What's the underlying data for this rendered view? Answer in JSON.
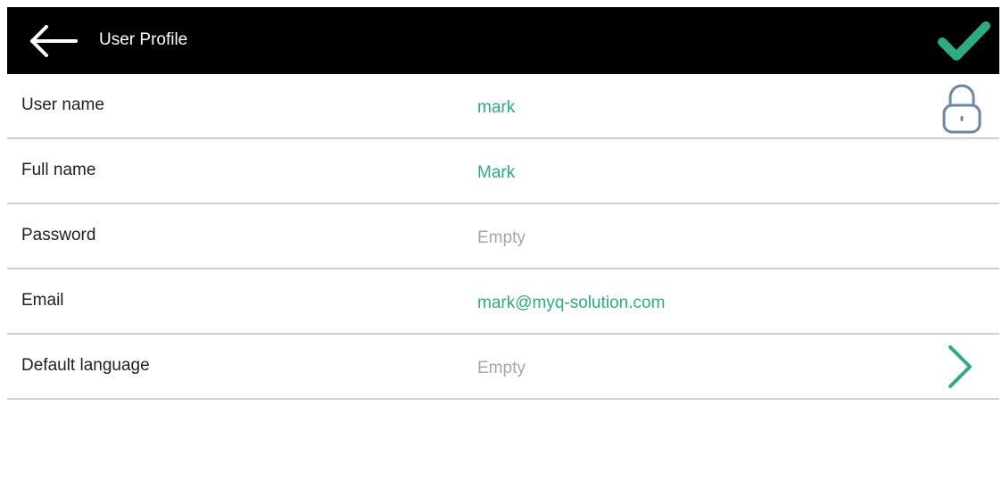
{
  "header": {
    "title": "User Profile",
    "back_icon": "arrow-left-icon",
    "confirm_icon": "checkmark-icon"
  },
  "fields": [
    {
      "label": "User name",
      "value": "mark",
      "state": "filled",
      "icon": "lock-icon"
    },
    {
      "label": "Full name",
      "value": "Mark",
      "state": "filled"
    },
    {
      "label": "Password",
      "value": "Empty",
      "state": "empty"
    },
    {
      "label": "Email",
      "value": "mark@myq-solution.com",
      "state": "filled"
    },
    {
      "label": "Default language",
      "value": "Empty",
      "state": "empty",
      "icon": "chevron-right-icon"
    }
  ],
  "colors": {
    "header_bg": "#000000",
    "accent": "#2bab86",
    "empty_text": "#a6a6a6",
    "divider": "#cfcfcf",
    "lock_icon": "#6b86a6"
  }
}
